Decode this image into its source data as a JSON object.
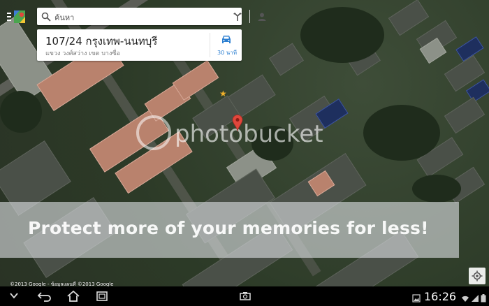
{
  "search": {
    "placeholder": "ค้นหา",
    "search_icon": "search-icon",
    "directions_icon": "directions-icon",
    "account_icon": "person-icon"
  },
  "place_card": {
    "title": "107/24 กรุงเทพ-นนทบุรี",
    "subtitle": "แขวง วงศ์สว่าง เขต บางซื่อ",
    "travel_icon": "car-icon",
    "travel_time": "30 นาที"
  },
  "map": {
    "marker_icon": "location-pin-icon",
    "starred_icon": "star-icon",
    "locate_icon": "my-location-icon",
    "copyright": "©2013 Google - ข้อมูลแผนที่ ©2013 Google"
  },
  "watermark": {
    "logo_text": "photobucket",
    "banner_text": "Protect more of your memories for less!"
  },
  "system_bar": {
    "back_icon": "back-icon",
    "home_icon": "home-icon",
    "recents_icon": "recent-apps-icon",
    "screenshot_icon": "screenshot-icon",
    "time": "16:26",
    "gallery_icon": "gallery-icon",
    "usb_icon": "usb-icon",
    "wifi_icon": "wifi-icon",
    "signal_icon": "signal-icon",
    "battery_icon": "battery-icon"
  },
  "colors": {
    "accent_blue": "#2c7fd1",
    "marker_red": "#e0473c",
    "star_gold": "#f2b12a"
  }
}
